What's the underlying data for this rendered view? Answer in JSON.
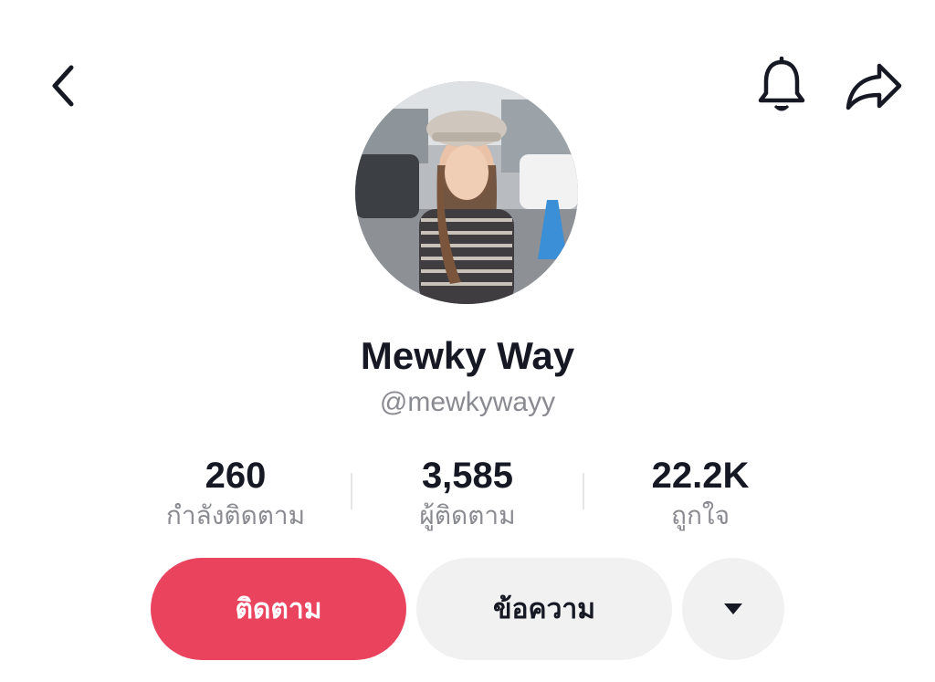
{
  "header": {
    "back_icon": "chevron-left-icon",
    "notification_icon": "bell-icon",
    "share_icon": "share-arrow-icon"
  },
  "profile": {
    "display_name": "Mewky Way",
    "username": "@mewkywayy"
  },
  "stats": [
    {
      "value": "260",
      "label": "กำลังติดตาม"
    },
    {
      "value": "3,585",
      "label": "ผู้ติดตาม"
    },
    {
      "value": "22.2K",
      "label": "ถูกใจ"
    }
  ],
  "actions": {
    "follow_label": "ติดตาม",
    "message_label": "ข้อความ",
    "more_icon": "caret-down-icon"
  },
  "colors": {
    "primary": "#ea435e",
    "secondary_bg": "#f1f1f2",
    "text_primary": "#161823",
    "text_secondary": "#8a8b91"
  }
}
